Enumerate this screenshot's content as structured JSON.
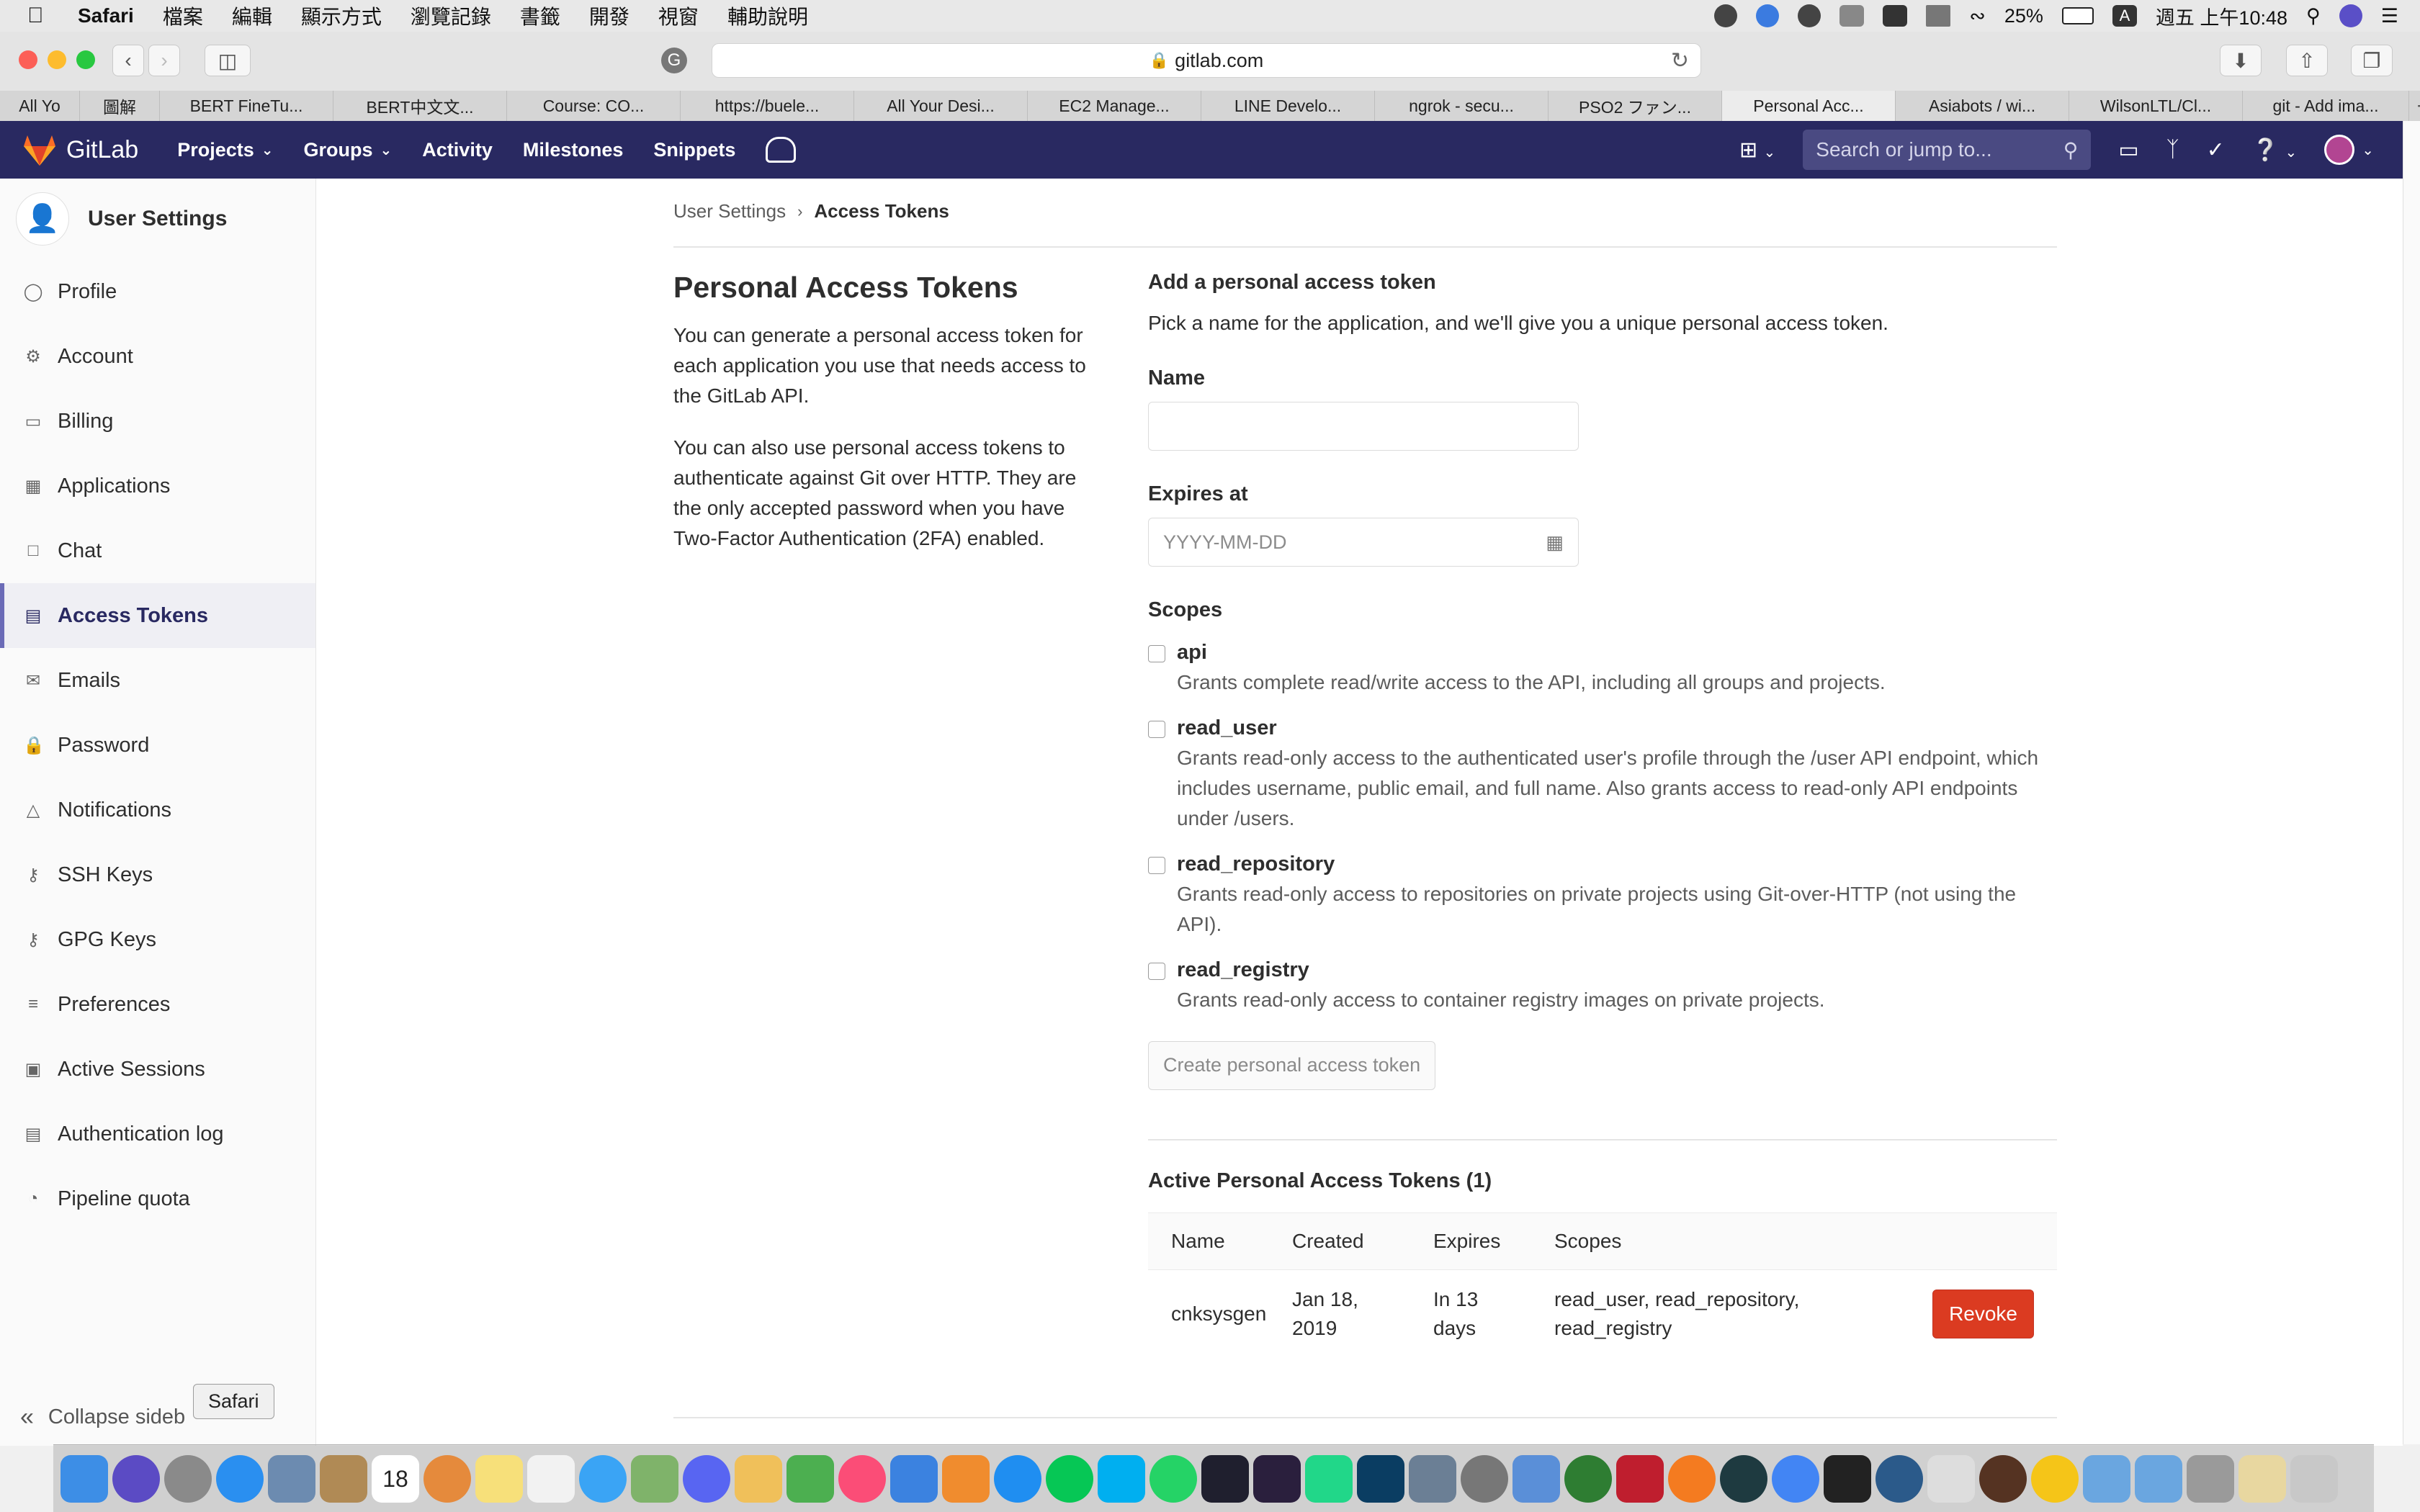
{
  "menubar": {
    "app": "Safari",
    "items": [
      "檔案",
      "編輯",
      "顯示方式",
      "瀏覽記錄",
      "書籤",
      "開發",
      "視窗",
      "輔助說明"
    ],
    "battery": "25%",
    "input_source": "A",
    "clock": "週五 上午10:48"
  },
  "browser": {
    "url": "gitlab.com",
    "tabs": [
      "All Yo",
      "圖解",
      "BERT FineTu...",
      "BERT中文文...",
      "Course: CO...",
      "https://buele...",
      "All Your Desi...",
      "EC2 Manage...",
      "LINE Develo...",
      "ngrok - secu...",
      "PSO2 ファン...",
      "Personal Acc...",
      "Asiabots / wi...",
      "WilsonLTL/Cl...",
      "git - Add ima..."
    ],
    "active_tab_index": 11
  },
  "gitlab_nav": {
    "brand": "GitLab",
    "links": [
      "Projects",
      "Groups",
      "Activity",
      "Milestones",
      "Snippets"
    ],
    "search_placeholder": "Search or jump to..."
  },
  "sidebar": {
    "title": "User Settings",
    "items": [
      {
        "label": "Profile",
        "icon": "profile-icon"
      },
      {
        "label": "Account",
        "icon": "account-icon"
      },
      {
        "label": "Billing",
        "icon": "billing-icon"
      },
      {
        "label": "Applications",
        "icon": "applications-icon"
      },
      {
        "label": "Chat",
        "icon": "chat-icon"
      },
      {
        "label": "Access Tokens",
        "icon": "access-tokens-icon",
        "active": true
      },
      {
        "label": "Emails",
        "icon": "emails-icon"
      },
      {
        "label": "Password",
        "icon": "lock-icon"
      },
      {
        "label": "Notifications",
        "icon": "bell-icon"
      },
      {
        "label": "SSH Keys",
        "icon": "key-icon"
      },
      {
        "label": "GPG Keys",
        "icon": "key-icon"
      },
      {
        "label": "Preferences",
        "icon": "preferences-icon"
      },
      {
        "label": "Active Sessions",
        "icon": "monitor-icon"
      },
      {
        "label": "Authentication log",
        "icon": "log-icon"
      },
      {
        "label": "Pipeline quota",
        "icon": "quota-icon"
      }
    ],
    "collapse_label": "Collapse sideb"
  },
  "breadcrumb": {
    "parent": "User Settings",
    "current": "Access Tokens"
  },
  "intro": {
    "title": "Personal Access Tokens",
    "p1": "You can generate a personal access token for each application you use that needs access to the GitLab API.",
    "p2": "You can also use personal access tokens to authenticate against Git over HTTP. They are the only accepted password when you have Two-Factor Authentication (2FA) enabled."
  },
  "form": {
    "heading": "Add a personal access token",
    "help": "Pick a name for the application, and we'll give you a unique personal access token.",
    "name_label": "Name",
    "name_value": "",
    "expires_label": "Expires at",
    "expires_placeholder": "YYYY-MM-DD",
    "scopes_label": "Scopes",
    "scopes": [
      {
        "name": "api",
        "desc": "Grants complete read/write access to the API, including all groups and projects.",
        "checked": false
      },
      {
        "name": "read_user",
        "desc": "Grants read-only access to the authenticated user's profile through the /user API endpoint, which includes username, public email, and full name. Also grants access to read-only API endpoints under /users.",
        "checked": false
      },
      {
        "name": "read_repository",
        "desc": "Grants read-only access to repositories on private projects using Git-over-HTTP (not using the API).",
        "checked": false
      },
      {
        "name": "read_registry",
        "desc": "Grants read-only access to container registry images on private projects.",
        "checked": false
      }
    ],
    "submit_label": "Create personal access token"
  },
  "active_tokens": {
    "title": "Active Personal Access Tokens (1)",
    "headers": [
      "Name",
      "Created",
      "Expires",
      "Scopes"
    ],
    "rows": [
      {
        "name": "cnksysgen",
        "created": "Jan 18, 2019",
        "expires": "In 13 days",
        "scopes": "read_user, read_repository, read_registry",
        "action": "Revoke"
      }
    ]
  },
  "tooltip": "Safari",
  "dock_calendar_day": "18"
}
